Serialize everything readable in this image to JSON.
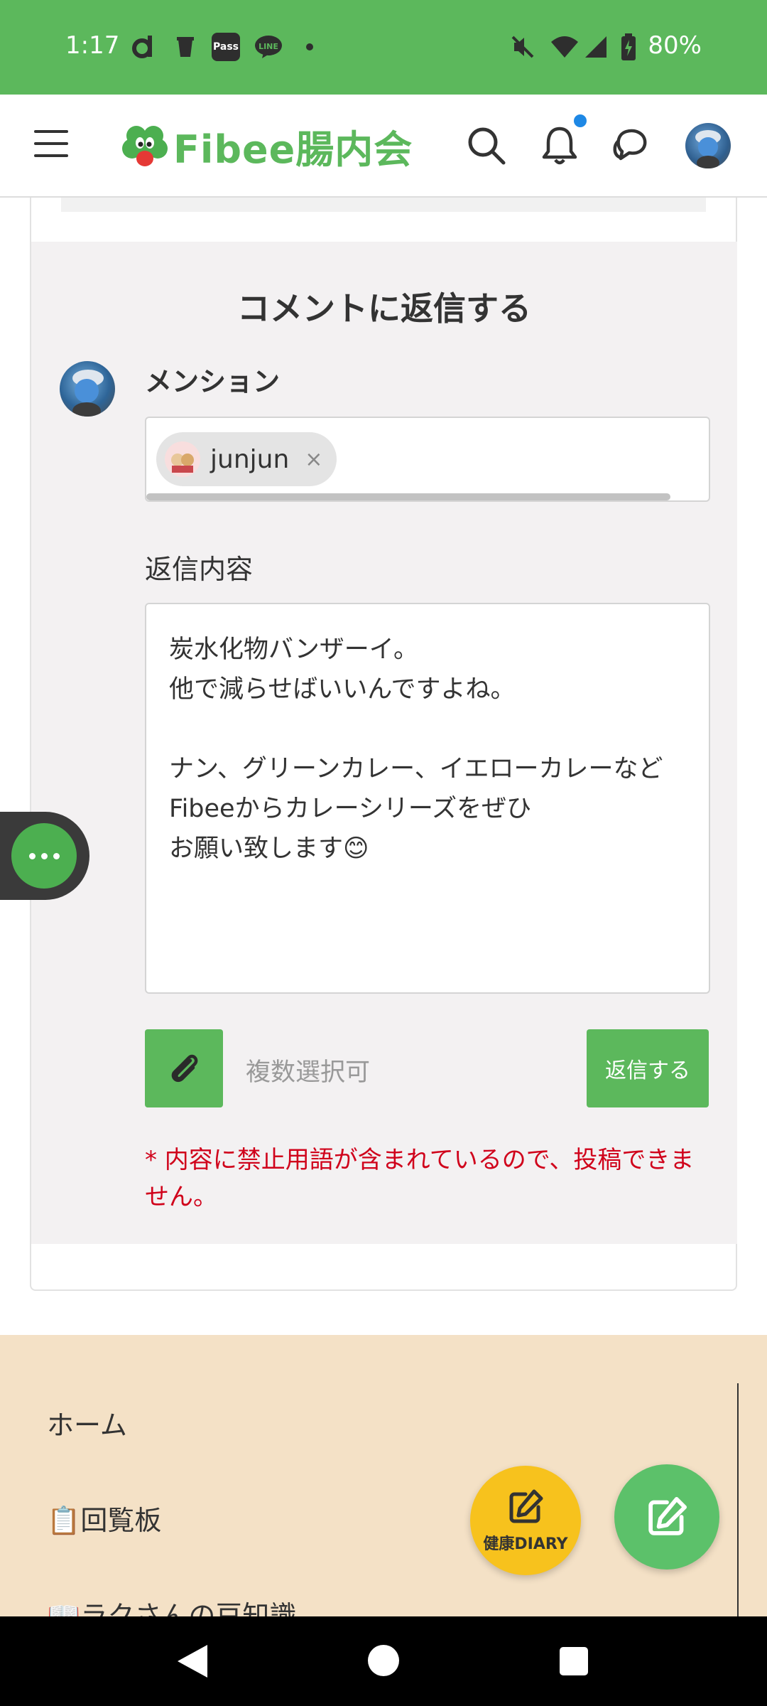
{
  "status_bar": {
    "time": "1:17",
    "battery": "80%",
    "app_icons": [
      "d",
      "▮",
      "Pass",
      "LINE",
      "•"
    ]
  },
  "header": {
    "logo_text": "Fibee腸内会",
    "brand_color": "#5cb85c",
    "notification_dot_color": "#1e88e5"
  },
  "reply_form": {
    "title": "コメントに返信する",
    "mention_label": "メンション",
    "mention_chips": [
      {
        "name": "junjun",
        "remove": "×"
      }
    ],
    "content_label": "返信内容",
    "content_value": "炭水化物バンザーイ。\n他で減らせばいいんですよね。\n\nナン、グリーンカレー、イエローカレーなどFibeeからカレーシリーズをぜひ\nお願い致します😊",
    "attach_placeholder": "複数選択可",
    "submit_label": "返信する",
    "error_message": "* 内容に禁止用語が含まれているので、投稿できません。",
    "error_color": "#d0021b"
  },
  "footer_menu": {
    "items": [
      "ホーム",
      "📋回覧板",
      "📖ラクさんの豆知識"
    ]
  },
  "fab": {
    "diary_label": "健康DIARY",
    "diary_color": "#f7c21d",
    "edit_color": "#5cc16a"
  }
}
